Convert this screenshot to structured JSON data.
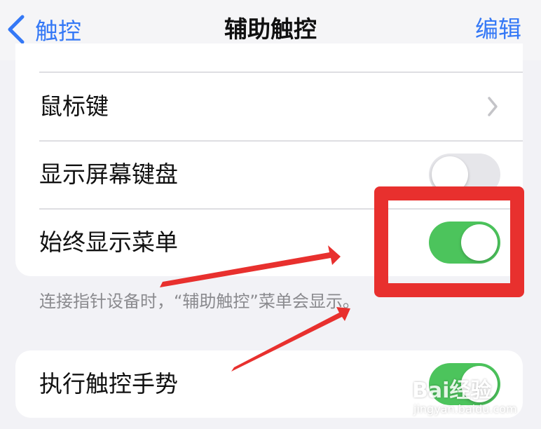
{
  "navbar": {
    "back_label": "触控",
    "title": "辅助触控",
    "edit_label": "编辑"
  },
  "settings": {
    "rows": [
      {
        "label": "鼠标键",
        "control": "chevron"
      },
      {
        "label": "显示屏幕键盘",
        "control": "toggle",
        "on": false
      },
      {
        "label": "始终显示菜单",
        "control": "toggle",
        "on": true
      }
    ],
    "footnote": "连接指针设备时，“辅助触控”菜单会显示。",
    "gesture_row": {
      "label": "执行触控手势",
      "control": "toggle",
      "on": true
    }
  },
  "annotation": {
    "highlight_color": "#e8302e"
  },
  "watermark": {
    "main": "Bai经验",
    "sub": "jingyan.baidu.com"
  },
  "colors": {
    "accent": "#3478f6",
    "toggle_on": "#4cc45c",
    "toggle_off": "#e6e6ea",
    "background": "#f2f2f6"
  },
  "icons": {
    "back": "chevron-left-icon",
    "disclosure": "chevron-right-icon"
  }
}
